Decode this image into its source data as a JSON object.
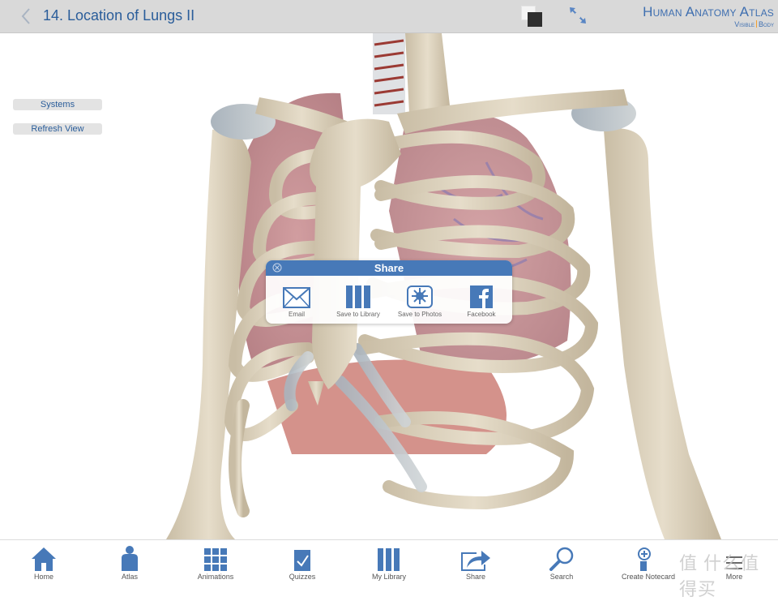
{
  "header": {
    "back_label": "Back",
    "title": "14. Location of Lungs II",
    "brand_title": "Human Anatomy Atlas",
    "brand_sub_left": "Visible",
    "brand_sub_right": "Body"
  },
  "sidebar": {
    "buttons": [
      {
        "label": "Systems"
      },
      {
        "label": "Refresh View"
      }
    ]
  },
  "share_popup": {
    "title": "Share",
    "items": [
      {
        "label": "Email",
        "icon": "envelope-icon"
      },
      {
        "label": "Save to Library",
        "icon": "library-icon"
      },
      {
        "label": "Save to Photos",
        "icon": "photos-icon"
      },
      {
        "label": "Facebook",
        "icon": "facebook-icon"
      }
    ]
  },
  "tabbar": {
    "items": [
      {
        "label": "Home",
        "icon": "home-icon"
      },
      {
        "label": "Atlas",
        "icon": "person-icon"
      },
      {
        "label": "Animations",
        "icon": "grid-icon"
      },
      {
        "label": "Quizzes",
        "icon": "checkbox-icon"
      },
      {
        "label": "My Library",
        "icon": "library-icon"
      },
      {
        "label": "Share",
        "icon": "share-icon"
      },
      {
        "label": "Search",
        "icon": "search-icon"
      },
      {
        "label": "Create Notecard",
        "icon": "notecard-icon"
      },
      {
        "label": "More",
        "icon": "more-icon"
      }
    ]
  },
  "watermark": "值 什么值得买",
  "colors": {
    "accent": "#4779b8",
    "title_text": "#2a5d9a",
    "topbar_bg": "#d9d9d9"
  }
}
